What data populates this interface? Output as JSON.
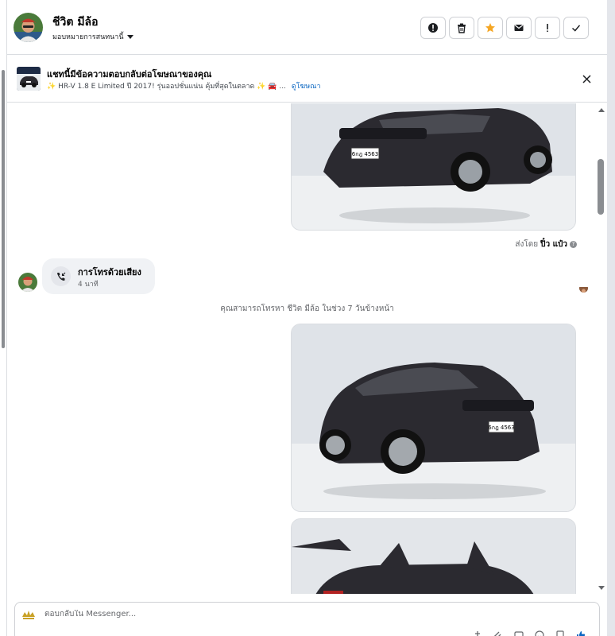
{
  "header": {
    "contact_name": "ชีวิต มีล้อ",
    "assign_label": "มอบหมายการสนทนานี้",
    "actions": [
      {
        "icon": "alert-circle-icon"
      },
      {
        "icon": "trash-icon"
      },
      {
        "icon": "star-icon"
      },
      {
        "icon": "envelope-icon"
      },
      {
        "icon": "exclamation-icon"
      },
      {
        "icon": "check-icon"
      }
    ]
  },
  "ad_banner": {
    "title": "แชทนี้มีข้อความตอบกลับต่อโฆษณาของคุณ",
    "description": "HR-V 1.8 E Limited ปี 2017! รุ่นออปชั่นแน่น คุ้มที่สุดในตลาด",
    "ellipsis": "...",
    "link_label": "ดูโฆษณา"
  },
  "thread": {
    "sent_by_prefix": "ส่งโดย",
    "sent_by_name": "ปิ๋ว แป๋ว",
    "call": {
      "title": "การโทรด้วยเสียง",
      "subtitle": "4 นาที"
    },
    "call_notice": "คุณสามารถโทรหา ชีวิต มีล้อ ในช่วง 7 วันข้างหน้า",
    "car_plate": "6กฎ 4563"
  },
  "composer": {
    "placeholder": "ตอบกลับใน Messenger..."
  },
  "colors": {
    "accent_blue": "#0a66c2",
    "star_orange": "#f5a623",
    "car_body": "#2b2a30"
  }
}
